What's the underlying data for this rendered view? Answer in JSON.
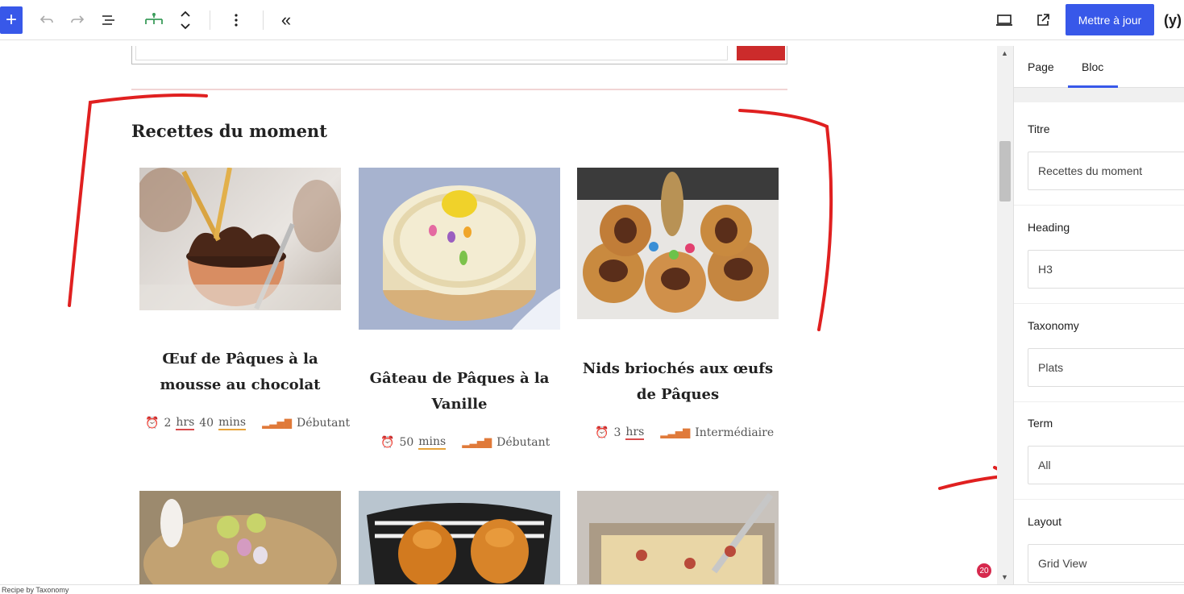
{
  "toolbar": {
    "update_label": "Mettre à jour"
  },
  "canvas": {
    "section_title": "Recettes du moment",
    "cards": [
      {
        "title": "Œuf de Pâques à la mousse au chocolat",
        "time": [
          "2",
          "hrs",
          "40",
          "mins"
        ],
        "level": "Débutant"
      },
      {
        "title": "Gâteau de Pâques à la Vanille",
        "time": [
          "50",
          "mins"
        ],
        "level": "Débutant"
      },
      {
        "title": "Nids briochés aux œufs de Pâques",
        "time": [
          "3",
          "hrs"
        ],
        "level": "Intermédiaire"
      }
    ],
    "notification_count": "20"
  },
  "sidebar": {
    "tabs": [
      "Page",
      "Bloc"
    ],
    "active_tab": "Bloc",
    "fields": [
      {
        "label": "Titre",
        "value": "Recettes du moment"
      },
      {
        "label": "Heading",
        "value": "H3"
      },
      {
        "label": "Taxonomy",
        "value": "Plats"
      },
      {
        "label": "Term",
        "value": "All"
      },
      {
        "label": "Layout",
        "value": "Grid View"
      }
    ]
  },
  "status_bar": {
    "text": "Recipe by Taxonomy"
  },
  "colors": {
    "accent": "#3858e9",
    "search_button": "#cc2b2b",
    "annotation": "#e02020"
  }
}
